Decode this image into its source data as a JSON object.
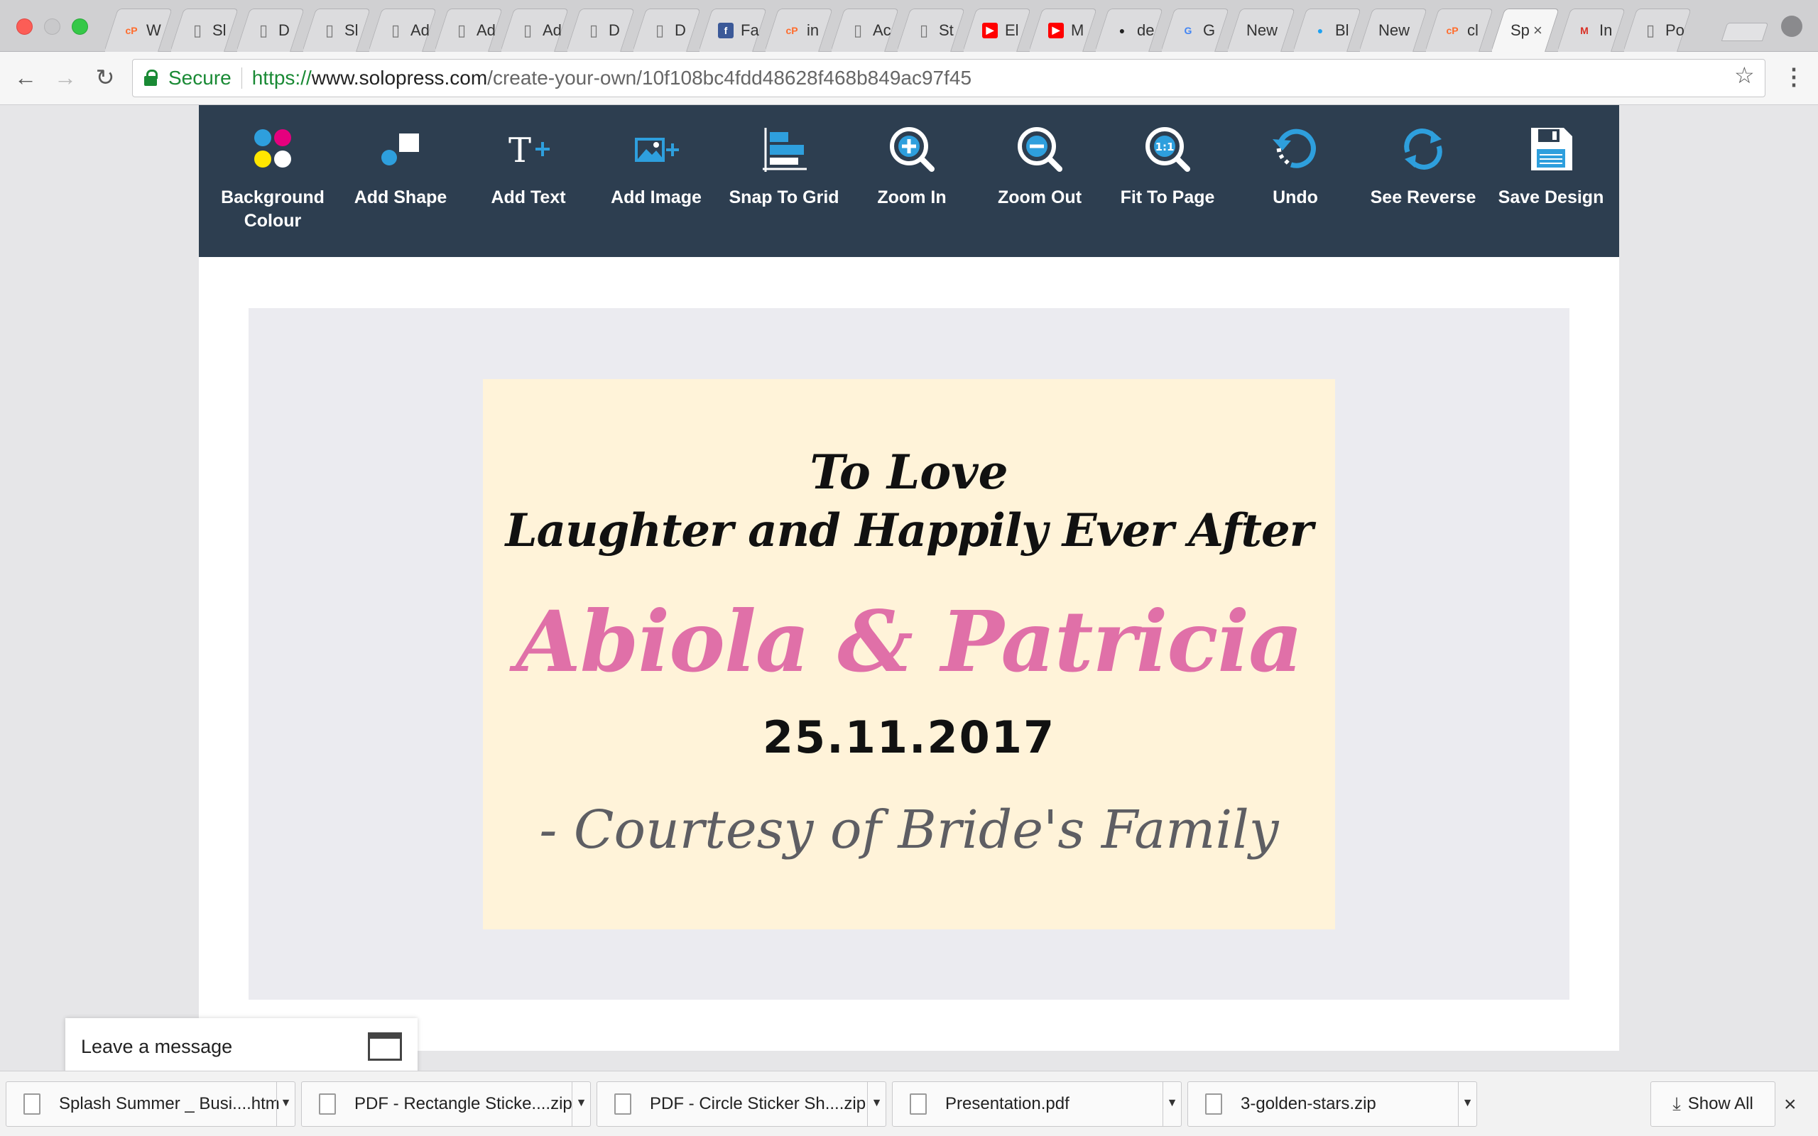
{
  "browser": {
    "tabs": [
      {
        "icon": "cpanel-icon",
        "title": "W",
        "color": "#ff6c2c"
      },
      {
        "icon": "page-icon",
        "title": "Sl",
        "color": "#777777"
      },
      {
        "icon": "page-icon",
        "title": "D",
        "color": "#777777"
      },
      {
        "icon": "page-icon",
        "title": "Sl",
        "color": "#777777"
      },
      {
        "icon": "page-icon",
        "title": "Ad",
        "color": "#777777"
      },
      {
        "icon": "page-icon",
        "title": "Ad",
        "color": "#777777"
      },
      {
        "icon": "page-icon",
        "title": "Ad",
        "color": "#777777"
      },
      {
        "icon": "page-icon",
        "title": "D",
        "color": "#777777"
      },
      {
        "icon": "page-icon",
        "title": "D",
        "color": "#777777"
      },
      {
        "icon": "facebook-icon",
        "title": "Fa",
        "color": "#3b5998"
      },
      {
        "icon": "cpanel-icon",
        "title": "in",
        "color": "#ff6c2c"
      },
      {
        "icon": "page-icon",
        "title": "Ac",
        "color": "#777777"
      },
      {
        "icon": "page-icon",
        "title": "St",
        "color": "#777777"
      },
      {
        "icon": "youtube-icon",
        "title": "El",
        "color": "#ff0000"
      },
      {
        "icon": "youtube-icon",
        "title": "M",
        "color": "#ff0000"
      },
      {
        "icon": "github-icon",
        "title": "de",
        "color": "#222222"
      },
      {
        "icon": "google-icon",
        "title": "G",
        "color": "#4285f4"
      },
      {
        "icon": "none",
        "title": "New",
        "color": ""
      },
      {
        "icon": "drop-icon",
        "title": "Bl",
        "color": "#1da1f2"
      },
      {
        "icon": "none",
        "title": "New",
        "color": ""
      },
      {
        "icon": "cpanel-icon",
        "title": "cl",
        "color": "#ff6c2c"
      },
      {
        "icon": "none",
        "title": "Sp",
        "color": "",
        "active": true
      },
      {
        "icon": "gmail-icon",
        "title": "In",
        "color": "#d93025"
      },
      {
        "icon": "page-icon",
        "title": "Po",
        "color": "#777777"
      }
    ],
    "active_tab_close": "×",
    "nav": {
      "back": "←",
      "forward": "→",
      "reload": "↻"
    },
    "security_label": "Secure",
    "url": {
      "scheme": "https://",
      "host": "www.solopress.com",
      "path": "/create-your-own/10f108bc4fdd48628f468b849ac97f45"
    },
    "bookmark_star": "☆",
    "menu": "⋮"
  },
  "editor_toolbar": {
    "tools": [
      {
        "label": "Background Colour",
        "icon": "palette-dots-icon"
      },
      {
        "label": "Add Shape",
        "icon": "shapes-icon"
      },
      {
        "label": "Add Text",
        "icon": "text-plus-icon"
      },
      {
        "label": "Add Image",
        "icon": "image-plus-icon"
      },
      {
        "label": "Snap To Grid",
        "icon": "align-left-icon"
      },
      {
        "label": "Zoom In",
        "icon": "zoom-in-icon"
      },
      {
        "label": "Zoom Out",
        "icon": "zoom-out-icon"
      },
      {
        "label": "Fit To Page",
        "icon": "fit-page-icon"
      },
      {
        "label": "Undo",
        "icon": "undo-icon"
      },
      {
        "label": "See Reverse",
        "icon": "rotate-icon"
      },
      {
        "label": "Save Design",
        "icon": "floppy-disk-icon"
      }
    ],
    "colors": {
      "bar": "#2d3e50",
      "accent": "#2e9fdd"
    }
  },
  "design": {
    "line1": "To Love",
    "line2": "Laughter and Happily Ever After",
    "names": "Abiola & Patricia",
    "date": "25.11.2017",
    "courtesy": "- Courtesy of Bride's Family",
    "colors": {
      "background": "#fff3d9",
      "names": "#e070a8",
      "courtesy": "#5e5e63"
    }
  },
  "chat_widget": {
    "label": "Leave a message"
  },
  "downloads": {
    "items": [
      {
        "name": "Splash Summer _ Busi....htm"
      },
      {
        "name": "PDF - Rectangle Sticke....zip"
      },
      {
        "name": "PDF - Circle Sticker Sh....zip"
      },
      {
        "name": "Presentation.pdf"
      },
      {
        "name": "3-golden-stars.zip"
      }
    ],
    "show_all": "Show All",
    "close": "×"
  }
}
